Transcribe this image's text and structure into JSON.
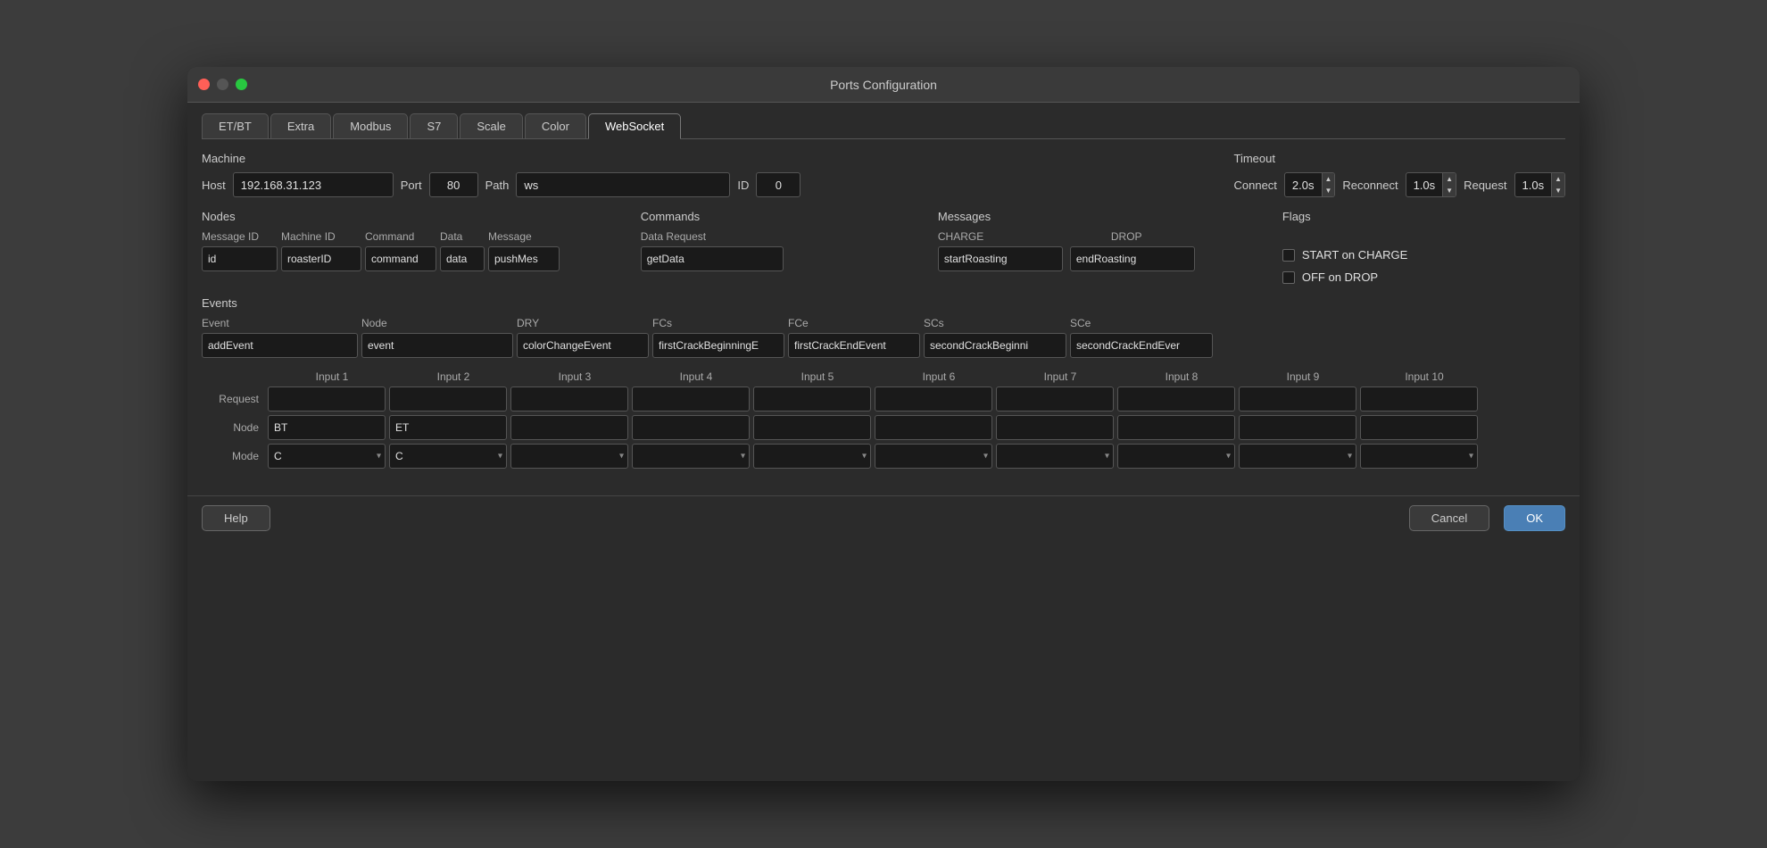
{
  "window": {
    "title": "Ports Configuration"
  },
  "tabs": [
    {
      "label": "ET/BT",
      "active": false
    },
    {
      "label": "Extra",
      "active": false
    },
    {
      "label": "Modbus",
      "active": false
    },
    {
      "label": "S7",
      "active": false
    },
    {
      "label": "Scale",
      "active": false
    },
    {
      "label": "Color",
      "active": false
    },
    {
      "label": "WebSocket",
      "active": true
    }
  ],
  "machine": {
    "label": "Machine",
    "host_label": "Host",
    "host_value": "192.168.31.123",
    "port_label": "Port",
    "port_value": "80",
    "path_label": "Path",
    "path_value": "ws",
    "id_label": "ID",
    "id_value": "0"
  },
  "timeout": {
    "label": "Timeout",
    "connect_label": "Connect",
    "connect_value": "2.0s",
    "reconnect_label": "Reconnect",
    "reconnect_value": "1.0s",
    "request_label": "Request",
    "request_value": "1.0s"
  },
  "nodes": {
    "label": "Nodes",
    "headers": [
      "Message ID",
      "Machine ID",
      "Command",
      "Data",
      "Message"
    ],
    "row": [
      "id",
      "roasterID",
      "command",
      "data",
      "pushMes"
    ]
  },
  "commands": {
    "label": "Commands",
    "headers": [
      "Data Request"
    ],
    "row": [
      "getData"
    ]
  },
  "messages": {
    "label": "Messages",
    "headers": [
      "CHARGE",
      "DROP"
    ],
    "row": [
      "startRoasting",
      "endRoasting"
    ]
  },
  "flags": {
    "label": "Flags",
    "items": [
      {
        "label": "START on CHARGE",
        "checked": false
      },
      {
        "label": "OFF on DROP",
        "checked": false
      }
    ]
  },
  "events": {
    "label": "Events",
    "headers": [
      "Event",
      "Node",
      "DRY",
      "FCs",
      "FCe",
      "SCs",
      "SCe"
    ],
    "row": [
      "addEvent",
      "event",
      "colorChangeEvent",
      "firstCrackBeginningE",
      "firstCrackEndEvent",
      "secondCrackBeginni",
      "secondCrackEndEver"
    ]
  },
  "inputs": {
    "headers": [
      "Input 1",
      "Input 2",
      "Input 3",
      "Input 4",
      "Input 5",
      "Input 6",
      "Input 7",
      "Input 8",
      "Input 9",
      "Input 10"
    ],
    "rows": {
      "request_label": "Request",
      "request_values": [
        "",
        "",
        "",
        "",
        "",
        "",
        "",
        "",
        "",
        ""
      ],
      "node_label": "Node",
      "node_values": [
        "BT",
        "ET",
        "",
        "",
        "",
        "",
        "",
        "",
        "",
        ""
      ],
      "mode_label": "Mode",
      "mode_values": [
        "C",
        "C",
        "",
        "",
        "",
        "",
        "",
        "",
        "",
        ""
      ]
    }
  },
  "footer": {
    "help_label": "Help",
    "cancel_label": "Cancel",
    "ok_label": "OK"
  }
}
